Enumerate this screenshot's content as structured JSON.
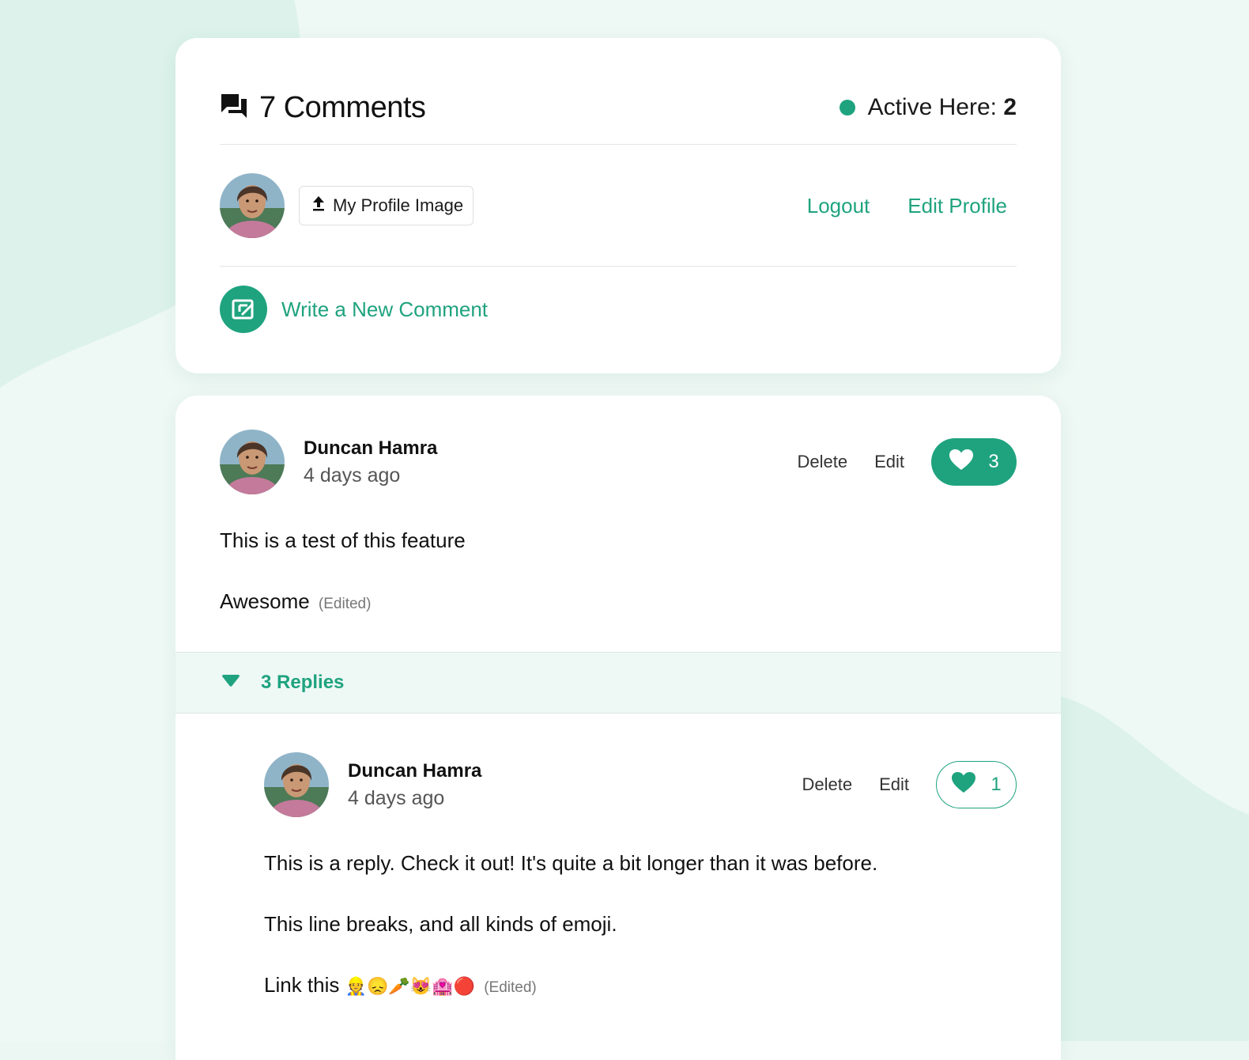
{
  "header": {
    "title": "7 Comments",
    "active_label": "Active Here:",
    "active_count": "2"
  },
  "profile": {
    "upload_label": "My Profile Image",
    "logout_label": "Logout",
    "edit_profile_label": "Edit Profile"
  },
  "write": {
    "label": "Write a New Comment"
  },
  "comment": {
    "author": "Duncan Hamra",
    "time": "4 days ago",
    "delete_label": "Delete",
    "edit_label": "Edit",
    "likes": "3",
    "body_line1": "This is a test of this feature",
    "body_line2": "Awesome",
    "edited": "(Edited)"
  },
  "replies": {
    "label": "3 Replies"
  },
  "reply": {
    "author": "Duncan Hamra",
    "time": "4 days ago",
    "delete_label": "Delete",
    "edit_label": "Edit",
    "likes": "1",
    "body_line1": "This is a reply. Check it out! It's quite a bit longer than it was before.",
    "body_line2": "This line breaks, and all kinds of emoji.",
    "body_line3_text": "Link this",
    "body_line3_emoji": "👷😞🥕😻🏩🔴",
    "edited": "(Edited)"
  },
  "colors": {
    "accent": "#1fa37f",
    "background": "#ecf7f3",
    "replies_bar": "#eef8f5"
  }
}
